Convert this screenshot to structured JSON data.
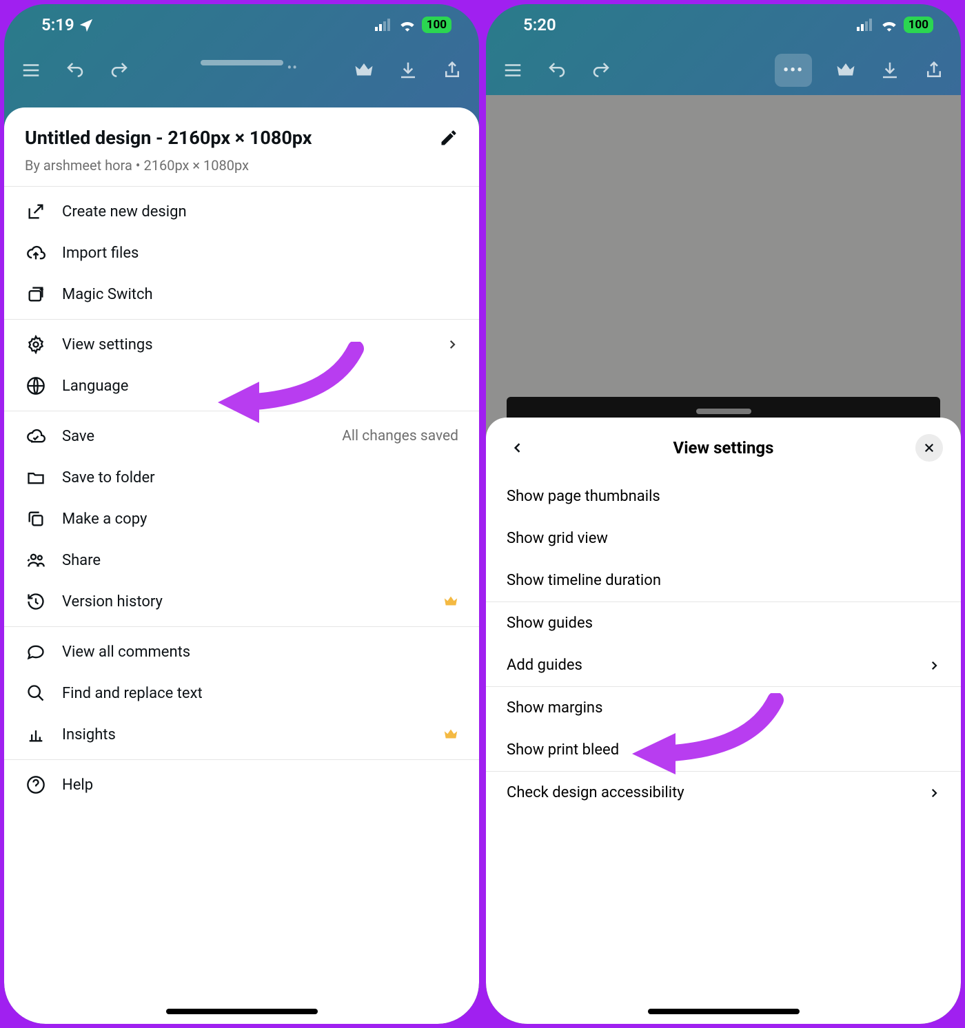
{
  "left": {
    "status": {
      "time": "5:19",
      "battery": "100"
    },
    "sheet": {
      "title": "Untitled design - 2160px × 1080px",
      "subtitle": "By arshmeet hora • 2160px × 1080px",
      "group1": {
        "create": "Create new design",
        "import": "Import files",
        "magic": "Magic Switch"
      },
      "group2": {
        "view_settings": "View settings",
        "language": "Language"
      },
      "group3": {
        "save": "Save",
        "save_status": "All changes saved",
        "save_folder": "Save to folder",
        "copy": "Make a copy",
        "share": "Share",
        "history": "Version history"
      },
      "group4": {
        "comments": "View all comments",
        "find": "Find and replace text",
        "insights": "Insights"
      },
      "group5": {
        "help": "Help"
      }
    }
  },
  "right": {
    "status": {
      "time": "5:20",
      "battery": "100"
    },
    "sheet": {
      "title": "View settings",
      "items": {
        "thumbnails": "Show page thumbnails",
        "grid": "Show grid view",
        "timeline": "Show timeline duration",
        "guides": "Show guides",
        "add_guides": "Add guides",
        "margins": "Show margins",
        "bleed": "Show print bleed",
        "accessibility": "Check design accessibility"
      }
    }
  }
}
